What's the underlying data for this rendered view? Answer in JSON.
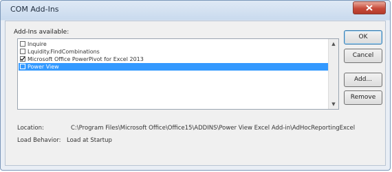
{
  "window": {
    "title": "COM Add-Ins"
  },
  "addins": {
    "label": "Add-Ins available:",
    "items": [
      {
        "label": "Inquire",
        "checked": false,
        "selected": false
      },
      {
        "label": "Lquidity.FindCombinations",
        "checked": false,
        "selected": false
      },
      {
        "label": "Microsoft Office PowerPivot for Excel 2013",
        "checked": true,
        "selected": false
      },
      {
        "label": "Power View",
        "checked": false,
        "selected": true
      }
    ]
  },
  "buttons": {
    "ok": "OK",
    "cancel": "Cancel",
    "add": "Add...",
    "remove": "Remove"
  },
  "details": {
    "location_label": "Location:",
    "location_value": "C:\\Program Files\\Microsoft Office\\Office15\\ADDINS\\Power View Excel Add-in\\AdHocReportingExcel",
    "load_behavior_label": "Load Behavior:",
    "load_behavior_value": "Load at Startup"
  }
}
